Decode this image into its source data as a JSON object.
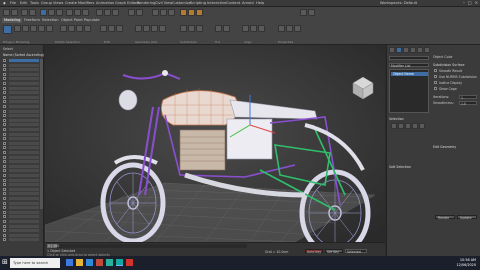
{
  "menubar": {
    "items": [
      "File",
      "Edit",
      "Tools",
      "Group",
      "Views",
      "Create",
      "Modifiers",
      "Animation",
      "Graph Editors",
      "Rendering",
      "Civil View",
      "Customize",
      "Scripting",
      "Interactive",
      "Content",
      "Arnold",
      "Help"
    ],
    "workspace": "Workspaces: Default"
  },
  "ribbon": {
    "tabs": [
      "Modeling",
      "Freeform",
      "Selection",
      "Object Paint",
      "Populate"
    ],
    "groups": [
      "Polygon Modeling",
      "Modify Selection",
      "Edit",
      "Geometry (All)",
      "Subdivision",
      "Tris",
      "Align",
      "Properties"
    ],
    "polygon_modeling_label": "Polygon Modeling"
  },
  "left_panel": {
    "title": "Select",
    "header": "Name (Sorted Ascending)"
  },
  "viewport": {
    "label": "[+] [Perspective ] [Standard ] [ Edged Faces ]"
  },
  "right_panel": {
    "object_name": "Object Color",
    "modifier_list": "Modifier List",
    "stack_item": "Object Name",
    "selection_title": "Selection",
    "soft_selection": "Soft Selection",
    "edit_geometry": "Edit Geometry",
    "subdivision": "Subdivision Surface",
    "options": [
      "Smooth Result",
      "Use NURMS Subdivision",
      "Isoline Display",
      "Show Cage"
    ],
    "iterations_label": "Iterations:",
    "iterations_value": "1",
    "smoothness_label": "Smoothness:",
    "smoothness_value": "1.0",
    "render_label": "Render",
    "update_label": "Update"
  },
  "status": {
    "selected": "1 Object Selected",
    "hint": "Click or click-and-drag to select objects",
    "frame": "0 / 100",
    "grid": "Grid = 10.0cm",
    "autokey": "Auto Key",
    "setkey": "Set Key",
    "selected_dropdown": "Selected"
  },
  "taskbar": {
    "search_placeholder": "Type here to search",
    "time": "10:56 AM",
    "date": "12/06/2020"
  },
  "colors": {
    "accent": "#3c6ea5",
    "bike_body": "#e8e8ee",
    "frame_purple": "#8a4fd1",
    "frame_green": "#2fbf6b"
  }
}
